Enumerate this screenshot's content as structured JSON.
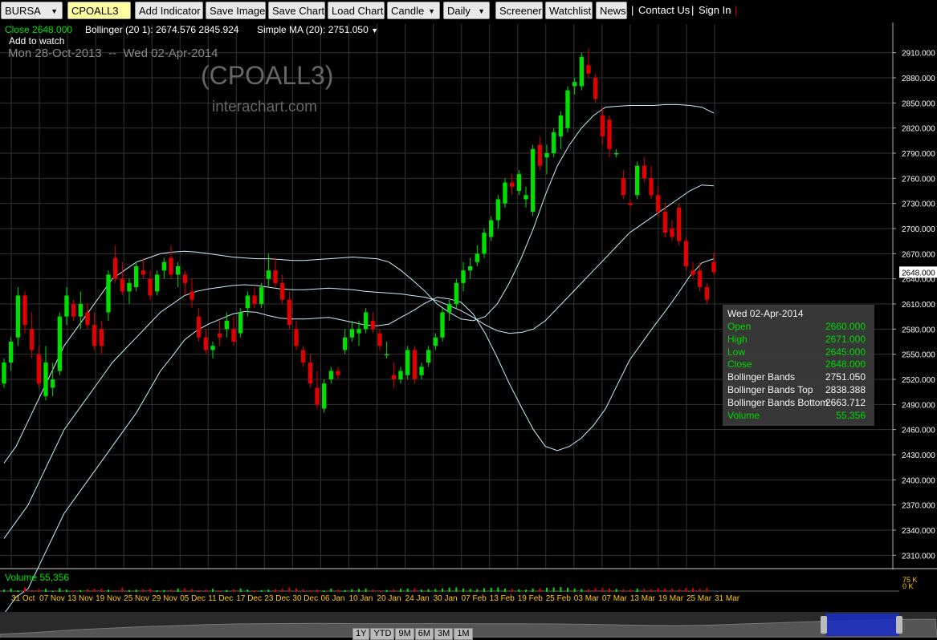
{
  "toolbar": {
    "exchange": "BURSA",
    "symbol": "CPOALL3",
    "add_indicator": "Add Indicator",
    "save_image": "Save Image",
    "save_chart": "Save Chart",
    "load_chart": "Load Chart",
    "chart_type": "Candle",
    "interval": "Daily",
    "screener": "Screener",
    "watchlist": "Watchlist",
    "news": "News",
    "contact_us": "Contact Us",
    "sign_in": "Sign In"
  },
  "legend": {
    "close": "Close 2648.000",
    "bollinger": "Bollinger (20 1): 2674.576 2845.924",
    "sma": "Simple MA (20): 2751.050",
    "add_to_watch": "Add to watch",
    "date_range": "Mon 28-Oct-2013  --  Wed 02-Apr-2014",
    "watermark_symbol": "(CPOALL3)",
    "watermark_site": "interachart.com",
    "volume": "Volume 55,356",
    "vol_axis_top": "75 K",
    "vol_axis_bottom": "0 K"
  },
  "tooltip": {
    "date": "Wed 02-Apr-2014",
    "rows": [
      {
        "label": "Open",
        "value": "2660.000",
        "color": "green"
      },
      {
        "label": "High",
        "value": "2671.000",
        "color": "green"
      },
      {
        "label": "Low",
        "value": "2645.000",
        "color": "green"
      },
      {
        "label": "Close",
        "value": "2648.000",
        "color": "green"
      },
      {
        "label": "Bollinger Bands",
        "value": "2751.050",
        "color": "white"
      },
      {
        "label": "Bollinger Bands Top",
        "value": "2838.388",
        "color": "white"
      },
      {
        "label": "Bollinger Bands Bottom",
        "value": "2663.712",
        "color": "white"
      },
      {
        "label": "Volume",
        "value": "55,356",
        "color": "green"
      }
    ]
  },
  "navigator": {
    "buttons": [
      "1Y",
      "YTD",
      "9M",
      "6M",
      "3M",
      "1M"
    ]
  },
  "colors": {
    "up": "#00e000",
    "down": "#e00000",
    "band": "#c8f0ff",
    "grid": "#333333",
    "background": "#000000"
  },
  "chart_data": {
    "type": "candlestick",
    "ylim": [
      2295,
      2925
    ],
    "y_ticks": [
      "2310.000",
      "2340.000",
      "2370.000",
      "2400.000",
      "2430.000",
      "2460.000",
      "2490.000",
      "2520.000",
      "2550.000",
      "2580.000",
      "2610.000",
      "2640.000",
      "2670.000",
      "2700.000",
      "2730.000",
      "2760.000",
      "2790.000",
      "2820.000",
      "2850.000",
      "2880.000",
      "2910.000"
    ],
    "current_price_label": "2648.000",
    "x_labels": [
      "31 Oct",
      "07 Nov",
      "13 Nov",
      "19 Nov",
      "25 Nov",
      "29 Nov",
      "05 Dec",
      "11 Dec",
      "17 Dec",
      "23 Dec",
      "30 Dec",
      "06 Jan",
      "10 Jan",
      "20 Jan",
      "24 Jan",
      "30 Jan",
      "07 Feb",
      "13 Feb",
      "19 Feb",
      "25 Feb",
      "03 Mar",
      "07 Mar",
      "13 Mar",
      "19 Mar",
      "25 Mar",
      "31 Mar"
    ],
    "ohlc": [
      [
        2515,
        2545,
        2510,
        2540
      ],
      [
        2540,
        2570,
        2530,
        2565
      ],
      [
        2570,
        2630,
        2560,
        2620
      ],
      [
        2620,
        2625,
        2575,
        2585
      ],
      [
        2580,
        2600,
        2545,
        2555
      ],
      [
        2550,
        2560,
        2510,
        2515
      ],
      [
        2500,
        2560,
        2495,
        2540
      ],
      [
        2510,
        2540,
        2500,
        2520
      ],
      [
        2530,
        2600,
        2525,
        2595
      ],
      [
        2595,
        2630,
        2585,
        2620
      ],
      [
        2610,
        2615,
        2590,
        2595
      ],
      [
        2595,
        2625,
        2580,
        2610
      ],
      [
        2600,
        2610,
        2580,
        2585
      ],
      [
        2585,
        2600,
        2555,
        2560
      ],
      [
        2580,
        2590,
        2550,
        2560
      ],
      [
        2600,
        2650,
        2590,
        2645
      ],
      [
        2665,
        2680,
        2635,
        2640
      ],
      [
        2640,
        2660,
        2620,
        2625
      ],
      [
        2625,
        2640,
        2610,
        2635
      ],
      [
        2630,
        2660,
        2625,
        2655
      ],
      [
        2650,
        2665,
        2640,
        2645
      ],
      [
        2640,
        2650,
        2615,
        2620
      ],
      [
        2625,
        2650,
        2620,
        2645
      ],
      [
        2650,
        2665,
        2640,
        2660
      ],
      [
        2665,
        2680,
        2640,
        2645
      ],
      [
        2645,
        2660,
        2630,
        2655
      ],
      [
        2645,
        2650,
        2620,
        2635
      ],
      [
        2625,
        2640,
        2605,
        2615
      ],
      [
        2595,
        2605,
        2565,
        2570
      ],
      [
        2570,
        2580,
        2550,
        2555
      ],
      [
        2555,
        2565,
        2545,
        2560
      ],
      [
        2575,
        2590,
        2560,
        2570
      ],
      [
        2580,
        2600,
        2570,
        2590
      ],
      [
        2580,
        2595,
        2560,
        2565
      ],
      [
        2575,
        2605,
        2570,
        2600
      ],
      [
        2605,
        2625,
        2595,
        2620
      ],
      [
        2620,
        2630,
        2605,
        2610
      ],
      [
        2610,
        2635,
        2605,
        2630
      ],
      [
        2640,
        2670,
        2630,
        2650
      ],
      [
        2650,
        2665,
        2630,
        2635
      ],
      [
        2635,
        2645,
        2610,
        2615
      ],
      [
        2615,
        2625,
        2580,
        2585
      ],
      [
        2580,
        2590,
        2555,
        2560
      ],
      [
        2555,
        2560,
        2535,
        2540
      ],
      [
        2540,
        2550,
        2510,
        2515
      ],
      [
        2510,
        2530,
        2485,
        2490
      ],
      [
        2485,
        2520,
        2480,
        2515
      ],
      [
        2520,
        2535,
        2515,
        2530
      ],
      [
        2530,
        2535,
        2520,
        2525
      ],
      [
        2555,
        2580,
        2550,
        2570
      ],
      [
        2570,
        2590,
        2565,
        2580
      ],
      [
        2575,
        2590,
        2560,
        2580
      ],
      [
        2580,
        2605,
        2575,
        2600
      ],
      [
        2590,
        2600,
        2575,
        2580
      ],
      [
        2575,
        2580,
        2555,
        2560
      ],
      [
        2550,
        2565,
        2545,
        2550
      ],
      [
        2525,
        2540,
        2510,
        2520
      ],
      [
        2520,
        2535,
        2515,
        2530
      ],
      [
        2525,
        2560,
        2520,
        2555
      ],
      [
        2555,
        2560,
        2515,
        2520
      ],
      [
        2525,
        2540,
        2520,
        2535
      ],
      [
        2540,
        2560,
        2535,
        2555
      ],
      [
        2560,
        2575,
        2555,
        2570
      ],
      [
        2570,
        2605,
        2565,
        2600
      ],
      [
        2600,
        2615,
        2590,
        2610
      ],
      [
        2610,
        2640,
        2605,
        2635
      ],
      [
        2635,
        2660,
        2625,
        2650
      ],
      [
        2650,
        2665,
        2640,
        2655
      ],
      [
        2660,
        2680,
        2655,
        2670
      ],
      [
        2670,
        2700,
        2665,
        2695
      ],
      [
        2690,
        2715,
        2685,
        2710
      ],
      [
        2710,
        2740,
        2700,
        2735
      ],
      [
        2730,
        2760,
        2725,
        2755
      ],
      [
        2755,
        2765,
        2740,
        2750
      ],
      [
        2745,
        2770,
        2740,
        2765
      ],
      [
        2735,
        2750,
        2725,
        2740
      ],
      [
        2720,
        2800,
        2715,
        2795
      ],
      [
        2800,
        2810,
        2770,
        2775
      ],
      [
        2785,
        2800,
        2765,
        2790
      ],
      [
        2790,
        2820,
        2785,
        2815
      ],
      [
        2810,
        2840,
        2795,
        2835
      ],
      [
        2820,
        2870,
        2815,
        2865
      ],
      [
        2870,
        2880,
        2860,
        2875
      ],
      [
        2870,
        2910,
        2865,
        2905
      ],
      [
        2895,
        2915,
        2880,
        2885
      ],
      [
        2880,
        2885,
        2850,
        2855
      ],
      [
        2835,
        2845,
        2800,
        2810
      ],
      [
        2830,
        2835,
        2785,
        2795
      ],
      [
        2790,
        2795,
        2785,
        2790
      ],
      [
        2760,
        2770,
        2735,
        2740
      ],
      [
        2730,
        2735,
        2725,
        2728
      ],
      [
        2740,
        2780,
        2735,
        2775
      ],
      [
        2775,
        2785,
        2755,
        2760
      ],
      [
        2760,
        2775,
        2735,
        2740
      ],
      [
        2740,
        2750,
        2715,
        2720
      ],
      [
        2720,
        2730,
        2690,
        2695
      ],
      [
        2700,
        2710,
        2685,
        2690
      ],
      [
        2725,
        2730,
        2680,
        2685
      ],
      [
        2685,
        2690,
        2650,
        2655
      ],
      [
        2650,
        2660,
        2640,
        2645
      ],
      [
        2650,
        2660,
        2625,
        2630
      ],
      [
        2630,
        2635,
        2610,
        2615
      ],
      [
        2660,
        2671,
        2645,
        2648
      ]
    ],
    "bollinger_mid": [
      2330,
      2350,
      2370,
      2400,
      2430,
      2460,
      2480,
      2500,
      2520,
      2540,
      2555,
      2570,
      2585,
      2600,
      2610,
      2620,
      2625,
      2628,
      2630,
      2632,
      2633,
      2632,
      2630,
      2628,
      2627,
      2627,
      2628,
      2629,
      2628,
      2627,
      2625,
      2624,
      2623,
      2622,
      2620,
      2618,
      2614,
      2608,
      2602,
      2594,
      2585,
      2578,
      2575,
      2576,
      2580,
      2590,
      2605,
      2620,
      2635,
      2650,
      2665,
      2680,
      2695,
      2705,
      2715,
      2725,
      2735,
      2745,
      2752,
      2751
    ],
    "bollinger_top": [
      2420,
      2440,
      2470,
      2500,
      2530,
      2560,
      2580,
      2600,
      2620,
      2640,
      2650,
      2660,
      2665,
      2670,
      2672,
      2673,
      2672,
      2670,
      2668,
      2666,
      2665,
      2664,
      2664,
      2663,
      2662,
      2662,
      2663,
      2664,
      2665,
      2666,
      2665,
      2664,
      2660,
      2650,
      2638,
      2625,
      2610,
      2600,
      2592,
      2590,
      2595,
      2610,
      2635,
      2665,
      2700,
      2740,
      2775,
      2800,
      2820,
      2835,
      2845,
      2846,
      2847,
      2847,
      2847,
      2848,
      2848,
      2847,
      2845,
      2838
    ],
    "bollinger_bottom": [
      2240,
      2260,
      2270,
      2300,
      2330,
      2360,
      2380,
      2400,
      2420,
      2440,
      2460,
      2480,
      2505,
      2530,
      2548,
      2567,
      2578,
      2586,
      2592,
      2598,
      2601,
      2600,
      2596,
      2593,
      2592,
      2592,
      2593,
      2594,
      2591,
      2588,
      2585,
      2584,
      2586,
      2594,
      2602,
      2611,
      2618,
      2616,
      2612,
      2598,
      2575,
      2546,
      2515,
      2487,
      2460,
      2440,
      2435,
      2440,
      2450,
      2465,
      2485,
      2514,
      2543,
      2563,
      2583,
      2602,
      2622,
      2643,
      2659,
      2664
    ],
    "volume": [
      30,
      45,
      20,
      60,
      25,
      35,
      40,
      15,
      50,
      30,
      20,
      25,
      35,
      40,
      45,
      30,
      20,
      55,
      25,
      30,
      35,
      40,
      20,
      25,
      30,
      45,
      50,
      35,
      25,
      30,
      40,
      20,
      25,
      35,
      45,
      30,
      20,
      25,
      30,
      35,
      40,
      55,
      45,
      35,
      25,
      30,
      20,
      45,
      30,
      25,
      35,
      40,
      45,
      30,
      20,
      25,
      35,
      40,
      45,
      50,
      30,
      35,
      40,
      45,
      55,
      60,
      45,
      40,
      35,
      50,
      55,
      60,
      45,
      40,
      35,
      30,
      45,
      50,
      55,
      60,
      65,
      55,
      45,
      40,
      35,
      50,
      55,
      45,
      40,
      35,
      30,
      45,
      40,
      35,
      50,
      45,
      40,
      35,
      55,
      50,
      40,
      55
    ]
  }
}
